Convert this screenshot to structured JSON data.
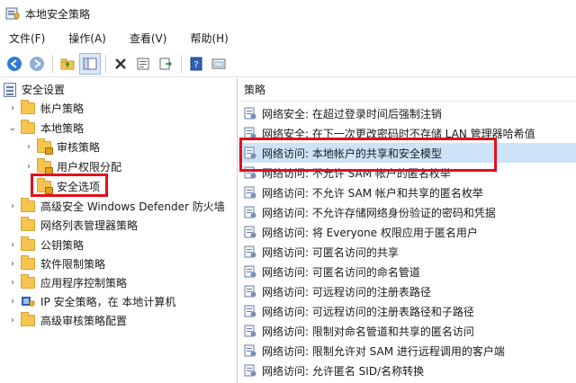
{
  "window": {
    "title": "本地安全策略"
  },
  "menu": [
    {
      "label": "文件(F)"
    },
    {
      "label": "操作(A)"
    },
    {
      "label": "查看(V)"
    },
    {
      "label": "帮助(H)"
    }
  ],
  "toolbar": {
    "buttons": [
      "back-arrow-icon",
      "forward-arrow-icon",
      "up-folder-icon",
      "show-hide-tree-icon",
      "delete-icon",
      "properties-icon",
      "export-list-icon",
      "help-icon",
      "console-view-icon"
    ]
  },
  "tree": {
    "root": "安全设置",
    "items": [
      {
        "label": "帐户策略"
      },
      {
        "label": "本地策略"
      },
      {
        "label": "审核策略"
      },
      {
        "label": "用户权限分配"
      },
      {
        "label": "安全选项"
      },
      {
        "label": "高级安全 Windows Defender 防火墙"
      },
      {
        "label": "网络列表管理器策略"
      },
      {
        "label": "公钥策略"
      },
      {
        "label": "软件限制策略"
      },
      {
        "label": "应用程序控制策略"
      },
      {
        "label": "IP 安全策略，在 本地计算机"
      },
      {
        "label": "高级审核策略配置"
      }
    ]
  },
  "list": {
    "column_header": "策略",
    "rows": [
      {
        "label": "网络安全: 在超过登录时间后强制注销"
      },
      {
        "label": "网络安全: 在下一次更改密码时不存储 LAN 管理器哈希值"
      },
      {
        "label": "网络访问: 本地帐户的共享和安全模型"
      },
      {
        "label": "网络访问: 不允许 SAM 帐户的匿名枚举"
      },
      {
        "label": "网络访问: 不允许 SAM 帐户和共享的匿名枚举"
      },
      {
        "label": "网络访问: 不允许存储网络身份验证的密码和凭据"
      },
      {
        "label": "网络访问: 将 Everyone 权限应用于匿名用户"
      },
      {
        "label": "网络访问: 可匿名访问的共享"
      },
      {
        "label": "网络访问: 可匿名访问的命名管道"
      },
      {
        "label": "网络访问: 可远程访问的注册表路径"
      },
      {
        "label": "网络访问: 可远程访问的注册表路径和子路径"
      },
      {
        "label": "网络访问: 限制对命名管道和共享的匿名访问"
      },
      {
        "label": "网络访问: 限制允许对 SAM 进行远程调用的客户端"
      },
      {
        "label": "网络访问: 允许匿名 SID/名称转换"
      }
    ]
  },
  "colors": {
    "highlight": "#e0101e",
    "selection": "#cce3f8",
    "folder": "#f5c54f"
  }
}
